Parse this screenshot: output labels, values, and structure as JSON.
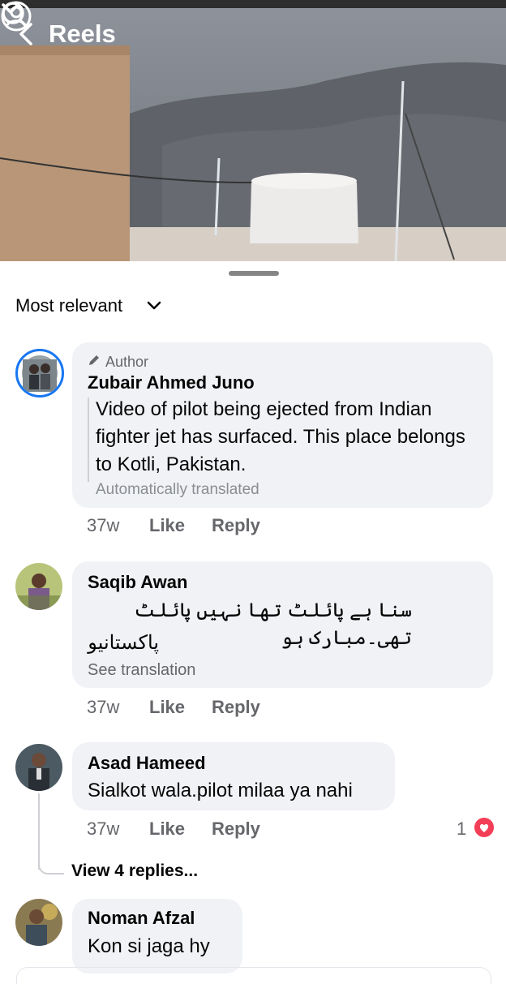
{
  "header": {
    "title": "Reels"
  },
  "icons": {
    "back": "chevron-left-icon",
    "dropdown": "chevron-down-icon",
    "search": "search-icon",
    "profile": "profile-icon"
  },
  "sort": {
    "label": "Most relevant"
  },
  "comments": [
    {
      "author_badge": "Author",
      "name": "Zubair Ahmed Juno",
      "text": "Video of pilot being ejected from Indian fighter jet has surfaced. This place belongs to Kotli, Pakistan.",
      "note": "Automatically translated",
      "time": "37w",
      "like": "Like",
      "reply": "Reply"
    },
    {
      "name": "Saqib Awan",
      "text_line1": "سنا ہے پائلٹ تھا نہیں پائلٹ تھی۔مبارک ہو",
      "text_line2": "پاکستانیو",
      "note": "See translation",
      "time": "37w",
      "like": "Like",
      "reply": "Reply"
    },
    {
      "name": "Asad Hameed",
      "text": "Sialkot wala.pilot milaa ya nahi",
      "time": "37w",
      "like": "Like",
      "reply": "Reply",
      "reaction_count": "1",
      "replies": "View 4 replies..."
    },
    {
      "name": "Noman Afzal",
      "text": "Kon si jaga hy"
    }
  ],
  "colors": {
    "accent": "#1877f2",
    "reaction": "#f33e58",
    "bubble": "#f0f2f5"
  }
}
